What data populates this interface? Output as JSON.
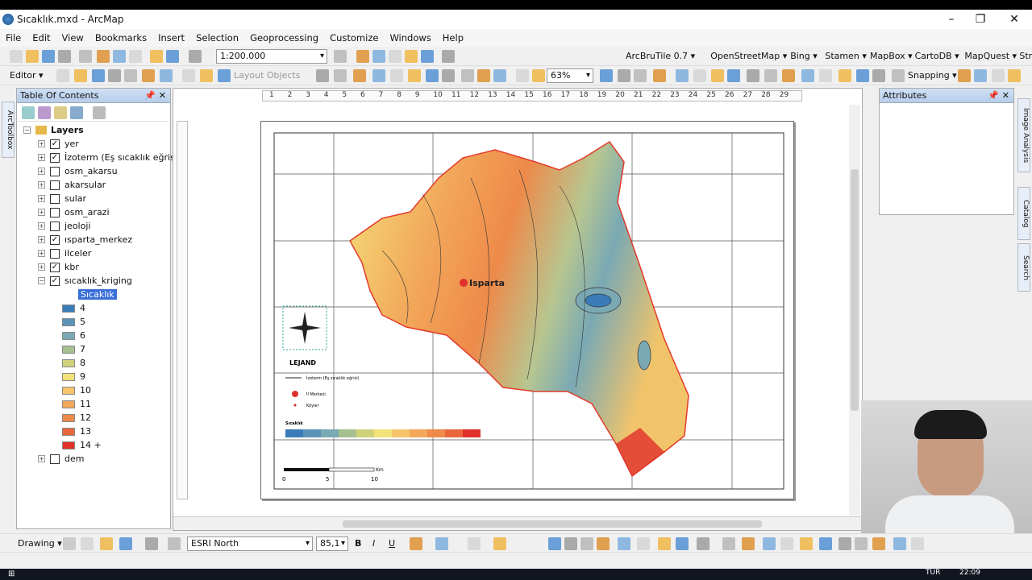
{
  "window": {
    "title": "Sıcaklık.mxd - ArcMap",
    "min": "–",
    "max": "❐",
    "close": "✕"
  },
  "menu": [
    "File",
    "Edit",
    "View",
    "Bookmarks",
    "Insert",
    "Selection",
    "Geoprocessing",
    "Customize",
    "Windows",
    "Help"
  ],
  "toolbar1": {
    "scale": "1:200.000",
    "basemaps": [
      "ArcBruTile 0.7 ▾",
      "OpenStreetMap ▾",
      "Bing ▾",
      "Stamen ▾",
      "MapBox ▾",
      "CartoDB ▾",
      "MapQuest ▾",
      "Strava ▾"
    ]
  },
  "toolbar2": {
    "editor": "Editor ▾",
    "layout_objects": "Layout Objects",
    "zoom": "63%",
    "snapping": "Snapping ▾"
  },
  "toc": {
    "title": "Table Of Contents",
    "root": "Layers",
    "layers": [
      {
        "name": "yer",
        "checked": true
      },
      {
        "name": "İzoterm (Eş sıcaklık eğrisi)",
        "checked": true
      },
      {
        "name": "osm_akarsu",
        "checked": false
      },
      {
        "name": "akarsular",
        "checked": false
      },
      {
        "name": "sular",
        "checked": false
      },
      {
        "name": "osm_arazi",
        "checked": false
      },
      {
        "name": "jeoloji",
        "checked": false
      },
      {
        "name": "ısparta_merkez",
        "checked": true
      },
      {
        "name": "ilceler",
        "checked": false
      },
      {
        "name": "kbr",
        "checked": true
      },
      {
        "name": "sıcaklık_kriging",
        "checked": true
      }
    ],
    "field": "Sıcaklık",
    "legend": [
      {
        "label": "4",
        "color": "#3a7cb8"
      },
      {
        "label": "5",
        "color": "#5b93b9"
      },
      {
        "label": "6",
        "color": "#7aa9b4"
      },
      {
        "label": "7",
        "color": "#a6c090"
      },
      {
        "label": "8",
        "color": "#cfd27a"
      },
      {
        "label": "9",
        "color": "#f2e27a"
      },
      {
        "label": "10",
        "color": "#f6c46a"
      },
      {
        "label": "11",
        "color": "#f2a75a"
      },
      {
        "label": "12",
        "color": "#ee8a4a"
      },
      {
        "label": "13",
        "color": "#e8663c"
      },
      {
        "label": "14 +",
        "color": "#e0302a"
      }
    ],
    "last": {
      "name": "dem",
      "checked": false
    }
  },
  "sidetabs": {
    "left": "ArcToolbox",
    "right": [
      "Image Analysis",
      "Catalog",
      "Search"
    ]
  },
  "attributes": {
    "title": "Attributes"
  },
  "map": {
    "city": "Isparta",
    "legend_title": "LEJAND",
    "legend_items": [
      "İzoterm (Eş sıcaklık eğrisi)",
      "İl Merkezi",
      "Köyler"
    ],
    "ramp_title": "Sıcaklık",
    "scale_unit": "Km",
    "scale_labels": [
      "0",
      "5",
      "10"
    ]
  },
  "ruler_top": [
    "1",
    "2",
    "3",
    "4",
    "5",
    "6",
    "7",
    "8",
    "9",
    "10",
    "11",
    "12",
    "13",
    "14",
    "15",
    "16",
    "17",
    "18",
    "19",
    "20",
    "21",
    "22",
    "23",
    "24",
    "25",
    "26",
    "27",
    "28",
    "29"
  ],
  "drawing": {
    "label": "Drawing ▾",
    "font": "ESRI North",
    "size": "85,1"
  },
  "taskbar": {
    "lang": "TUR",
    "time": "22:09"
  }
}
